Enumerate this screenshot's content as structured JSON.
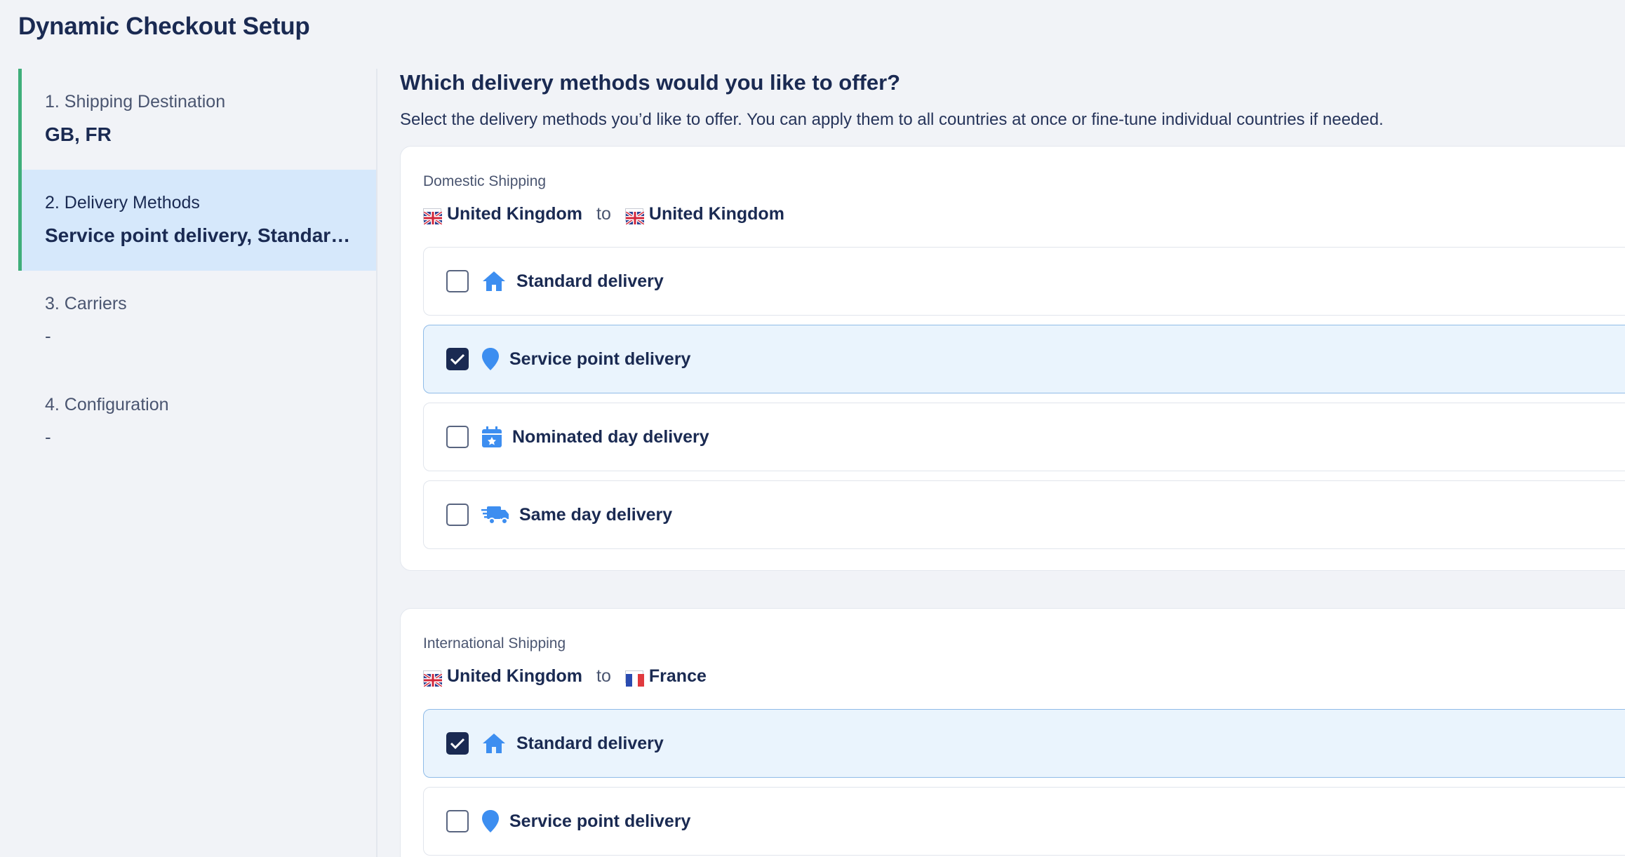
{
  "page_title": "Dynamic Checkout Setup",
  "sidebar": {
    "steps": [
      {
        "label": "1. Shipping Destination",
        "value": "GB, FR"
      },
      {
        "label": "2. Delivery Methods",
        "value": "Service point delivery, Standard ..."
      },
      {
        "label": "3. Carriers",
        "value": "-"
      },
      {
        "label": "4. Configuration",
        "value": "-"
      }
    ]
  },
  "main": {
    "heading": "Which delivery methods would you like to offer?",
    "subtitle": "Select the delivery methods you’d like to offer. You can apply them to all countries at once or fine-tune individual countries if needed.",
    "domestic": {
      "caption": "Domestic Shipping",
      "from": "United Kingdom",
      "to_word": "to",
      "to": "United Kingdom",
      "options": [
        {
          "label": "Standard delivery",
          "icon": "home-icon",
          "checked": false
        },
        {
          "label": "Service point delivery",
          "icon": "map-pin-icon",
          "checked": true
        },
        {
          "label": "Nominated day delivery",
          "icon": "calendar-star-icon",
          "checked": false
        },
        {
          "label": "Same day delivery",
          "icon": "truck-fast-icon",
          "checked": false
        }
      ]
    },
    "international": {
      "caption": "International Shipping",
      "from": "United Kingdom",
      "to_word": "to",
      "to": "France",
      "options": [
        {
          "label": "Standard delivery",
          "icon": "home-icon",
          "checked": true
        },
        {
          "label": "Service point delivery",
          "icon": "map-pin-icon",
          "checked": false
        }
      ]
    }
  },
  "colors": {
    "navy": "#1a2a52",
    "accent_green": "#3fae7a",
    "active_step_bg": "#d6e8fb",
    "checked_option_bg": "#eaf4fd",
    "icon_blue": "#3d8ef0"
  }
}
